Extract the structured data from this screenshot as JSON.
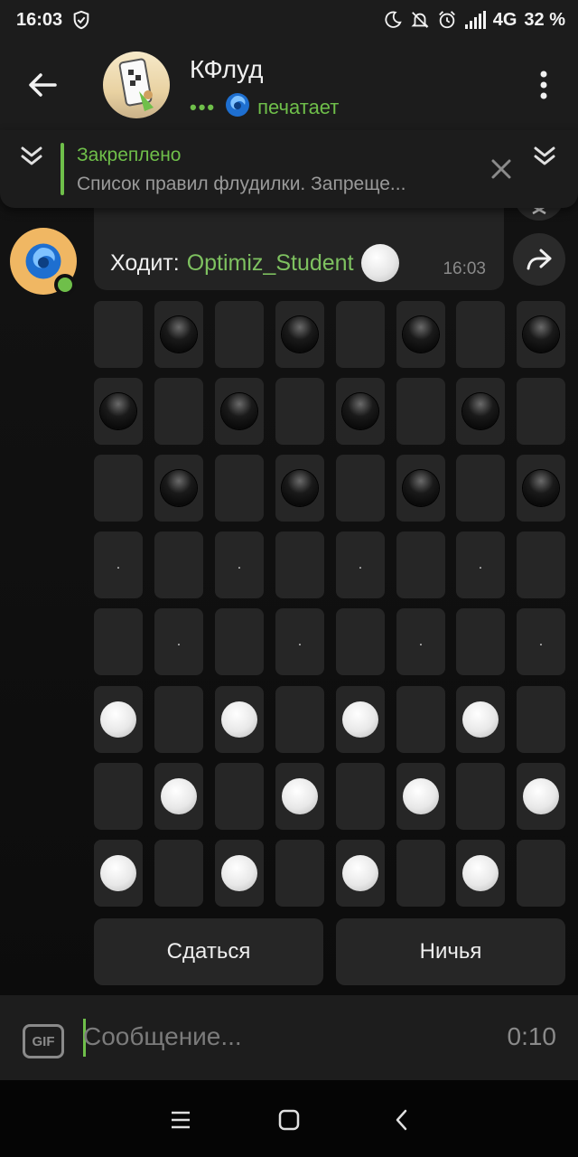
{
  "status_bar": {
    "time": "16:03",
    "network": "4G",
    "battery": "32 %"
  },
  "header": {
    "chat_title": "КФлуд",
    "typing_dots": "•••",
    "status": "печатает"
  },
  "pinned": {
    "title": "Закреплено",
    "text": "Список правил флудилки.  Запреще..."
  },
  "message": {
    "label": "Ходит:",
    "player": "Optimiz_Student",
    "time": "16:03"
  },
  "board": {
    "rows": [
      [
        "",
        "b",
        "",
        "b",
        "",
        "b",
        "",
        "b"
      ],
      [
        "b",
        "",
        "b",
        "",
        "b",
        "",
        "b",
        ""
      ],
      [
        "",
        "b",
        "",
        "b",
        "",
        "b",
        "",
        "b"
      ],
      [
        ".",
        "",
        ".",
        "",
        ".",
        "",
        ".",
        ""
      ],
      [
        "",
        ".",
        "",
        ".",
        "",
        ".",
        "",
        "."
      ],
      [
        "w",
        "",
        "w",
        "",
        "w",
        "",
        "w",
        ""
      ],
      [
        "",
        "w",
        "",
        "w",
        "",
        "w",
        "",
        "w"
      ],
      [
        "w",
        "",
        "w",
        "",
        "w",
        "",
        "w",
        ""
      ]
    ]
  },
  "actions": {
    "surrender": "Сдаться",
    "draw": "Ничья"
  },
  "input": {
    "gif_label": "GIF",
    "placeholder": "Сообщение...",
    "timer": "0:10"
  },
  "colors": {
    "accent": "#6fbf4a",
    "background": "#0f0f0f",
    "panel": "#1c1c1c",
    "cell": "#262626"
  }
}
